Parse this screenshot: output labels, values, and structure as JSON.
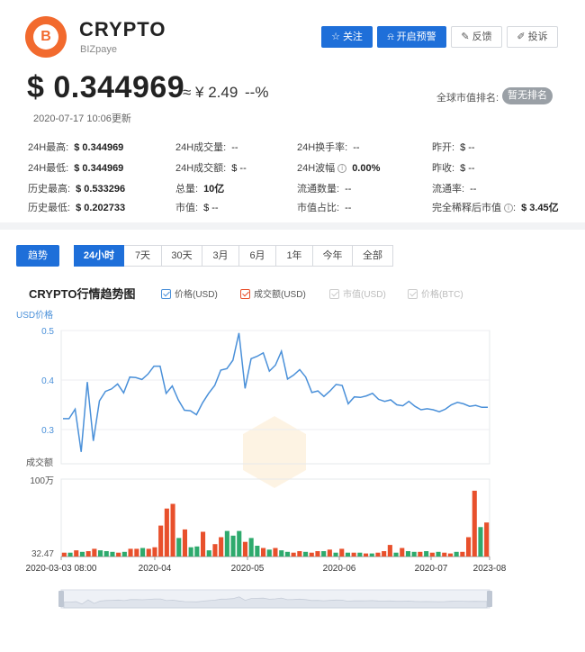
{
  "coin": {
    "name": "CRYPTO",
    "sub": "BIZpaye",
    "logo_letter": "B",
    "price": "$ 0.344969",
    "cny": "≈ ¥ 2.49",
    "change": "--%",
    "updated": "2020-07-17 10:06更新",
    "rank_label": "全球市值排名:",
    "rank_value": "暂无排名"
  },
  "actions": {
    "follow": "关注",
    "alert": "开启预警",
    "feedback": "反馈",
    "complain": "投诉"
  },
  "stats": [
    [
      {
        "label": "24H最高:",
        "value": "$ 0.344969"
      },
      {
        "label": "24H成交量:",
        "value": "--"
      },
      {
        "label": "24H换手率:",
        "value": "--"
      },
      {
        "label": "昨开:",
        "value": "$ --"
      }
    ],
    [
      {
        "label": "24H最低:",
        "value": "$ 0.344969"
      },
      {
        "label": "24H成交额:",
        "value": "$ --"
      },
      {
        "label": "24H波幅",
        "value": "0.00%"
      },
      {
        "label": "昨收:",
        "value": "$ --"
      }
    ],
    [
      {
        "label": "历史最高:",
        "value": "$ 0.533296"
      },
      {
        "label": "总量:",
        "value": "10亿"
      },
      {
        "label": "流通数量:",
        "value": "--"
      },
      {
        "label": "流通率:",
        "value": "--"
      }
    ],
    [
      {
        "label": "历史最低:",
        "value": "$ 0.202733"
      },
      {
        "label": "市值:",
        "value": "$ --"
      },
      {
        "label": "市值占比:",
        "value": "--"
      },
      {
        "label": "完全稀释后市值",
        "value": "$ 3.45亿"
      }
    ]
  ],
  "chart_tabs": {
    "trend": "趋势",
    "ranges": [
      "24小时",
      "7天",
      "30天",
      "3月",
      "6月",
      "1年",
      "今年",
      "全部"
    ],
    "active_range": "24小时"
  },
  "chart_header": {
    "title": "CRYPTO行情趋势图",
    "legend": [
      {
        "name": "价格(USD)",
        "checked": true,
        "color": "#4a90d9"
      },
      {
        "name": "成交额(USD)",
        "checked": true,
        "color": "#e8502c"
      },
      {
        "name": "市值(USD)",
        "checked": false,
        "color": "#cccccc"
      },
      {
        "name": "价格(BTC)",
        "checked": false,
        "color": "#cccccc"
      }
    ]
  },
  "chart_data": {
    "type": "line",
    "price_axis_label": "USD价格",
    "volume_axis_label": "成交额",
    "price_ticks": [
      "0.5",
      "0.4",
      "0.3"
    ],
    "volume_ticks": [
      "100万",
      "32.47"
    ],
    "x_ticks": [
      "2020-03-03 08:00",
      "2020-04",
      "2020-05",
      "2020-06",
      "2020-07",
      "2023-08"
    ],
    "ylim": [
      0.3,
      0.5
    ],
    "price_series": {
      "name": "价格(USD)",
      "color": "#4a90d9",
      "values": [
        0.322,
        0.322,
        0.341,
        0.255,
        0.396,
        0.277,
        0.358,
        0.377,
        0.382,
        0.392,
        0.374,
        0.406,
        0.405,
        0.401,
        0.412,
        0.428,
        0.428,
        0.373,
        0.388,
        0.36,
        0.339,
        0.338,
        0.33,
        0.354,
        0.373,
        0.389,
        0.42,
        0.423,
        0.44,
        0.495,
        0.383,
        0.443,
        0.448,
        0.455,
        0.418,
        0.43,
        0.458,
        0.402,
        0.41,
        0.421,
        0.406,
        0.375,
        0.378,
        0.367,
        0.378,
        0.391,
        0.389,
        0.352,
        0.366,
        0.365,
        0.368,
        0.373,
        0.361,
        0.357,
        0.36,
        0.35,
        0.348,
        0.357,
        0.347,
        0.34,
        0.342,
        0.34,
        0.336,
        0.341,
        0.35,
        0.355,
        0.352,
        0.347,
        0.349,
        0.345,
        0.345
      ]
    },
    "volume_series": {
      "name": "成交额(USD)",
      "up_color": "#e8502c",
      "down_color": "#2eaa6d",
      "values": [
        0.05,
        0.05,
        0.08,
        0.06,
        0.07,
        0.1,
        0.08,
        0.07,
        0.06,
        0.05,
        0.06,
        0.1,
        0.1,
        0.11,
        0.1,
        0.12,
        0.4,
        0.62,
        0.68,
        0.24,
        0.35,
        0.12,
        0.13,
        0.32,
        0.08,
        0.16,
        0.25,
        0.33,
        0.27,
        0.33,
        0.19,
        0.24,
        0.14,
        0.11,
        0.09,
        0.11,
        0.08,
        0.06,
        0.05,
        0.07,
        0.06,
        0.05,
        0.07,
        0.07,
        0.09,
        0.05,
        0.1,
        0.05,
        0.05,
        0.05,
        0.04,
        0.04,
        0.05,
        0.07,
        0.15,
        0.05,
        0.11,
        0.07,
        0.06,
        0.06,
        0.07,
        0.05,
        0.06,
        0.05,
        0.04,
        0.06,
        0.06,
        0.25,
        0.85,
        0.38,
        0.44
      ],
      "up": [
        1,
        0,
        1,
        0,
        1,
        1,
        0,
        0,
        0,
        1,
        0,
        1,
        1,
        0,
        1,
        1,
        1,
        1,
        1,
        0,
        1,
        0,
        0,
        1,
        0,
        1,
        1,
        0,
        0,
        0,
        1,
        0,
        0,
        1,
        0,
        1,
        0,
        0,
        1,
        1,
        0,
        1,
        1,
        0,
        1,
        0,
        1,
        0,
        1,
        0,
        1,
        0,
        1,
        1,
        1,
        0,
        1,
        0,
        0,
        1,
        0,
        1,
        0,
        1,
        1,
        0,
        1,
        1,
        1,
        0,
        1
      ]
    }
  }
}
